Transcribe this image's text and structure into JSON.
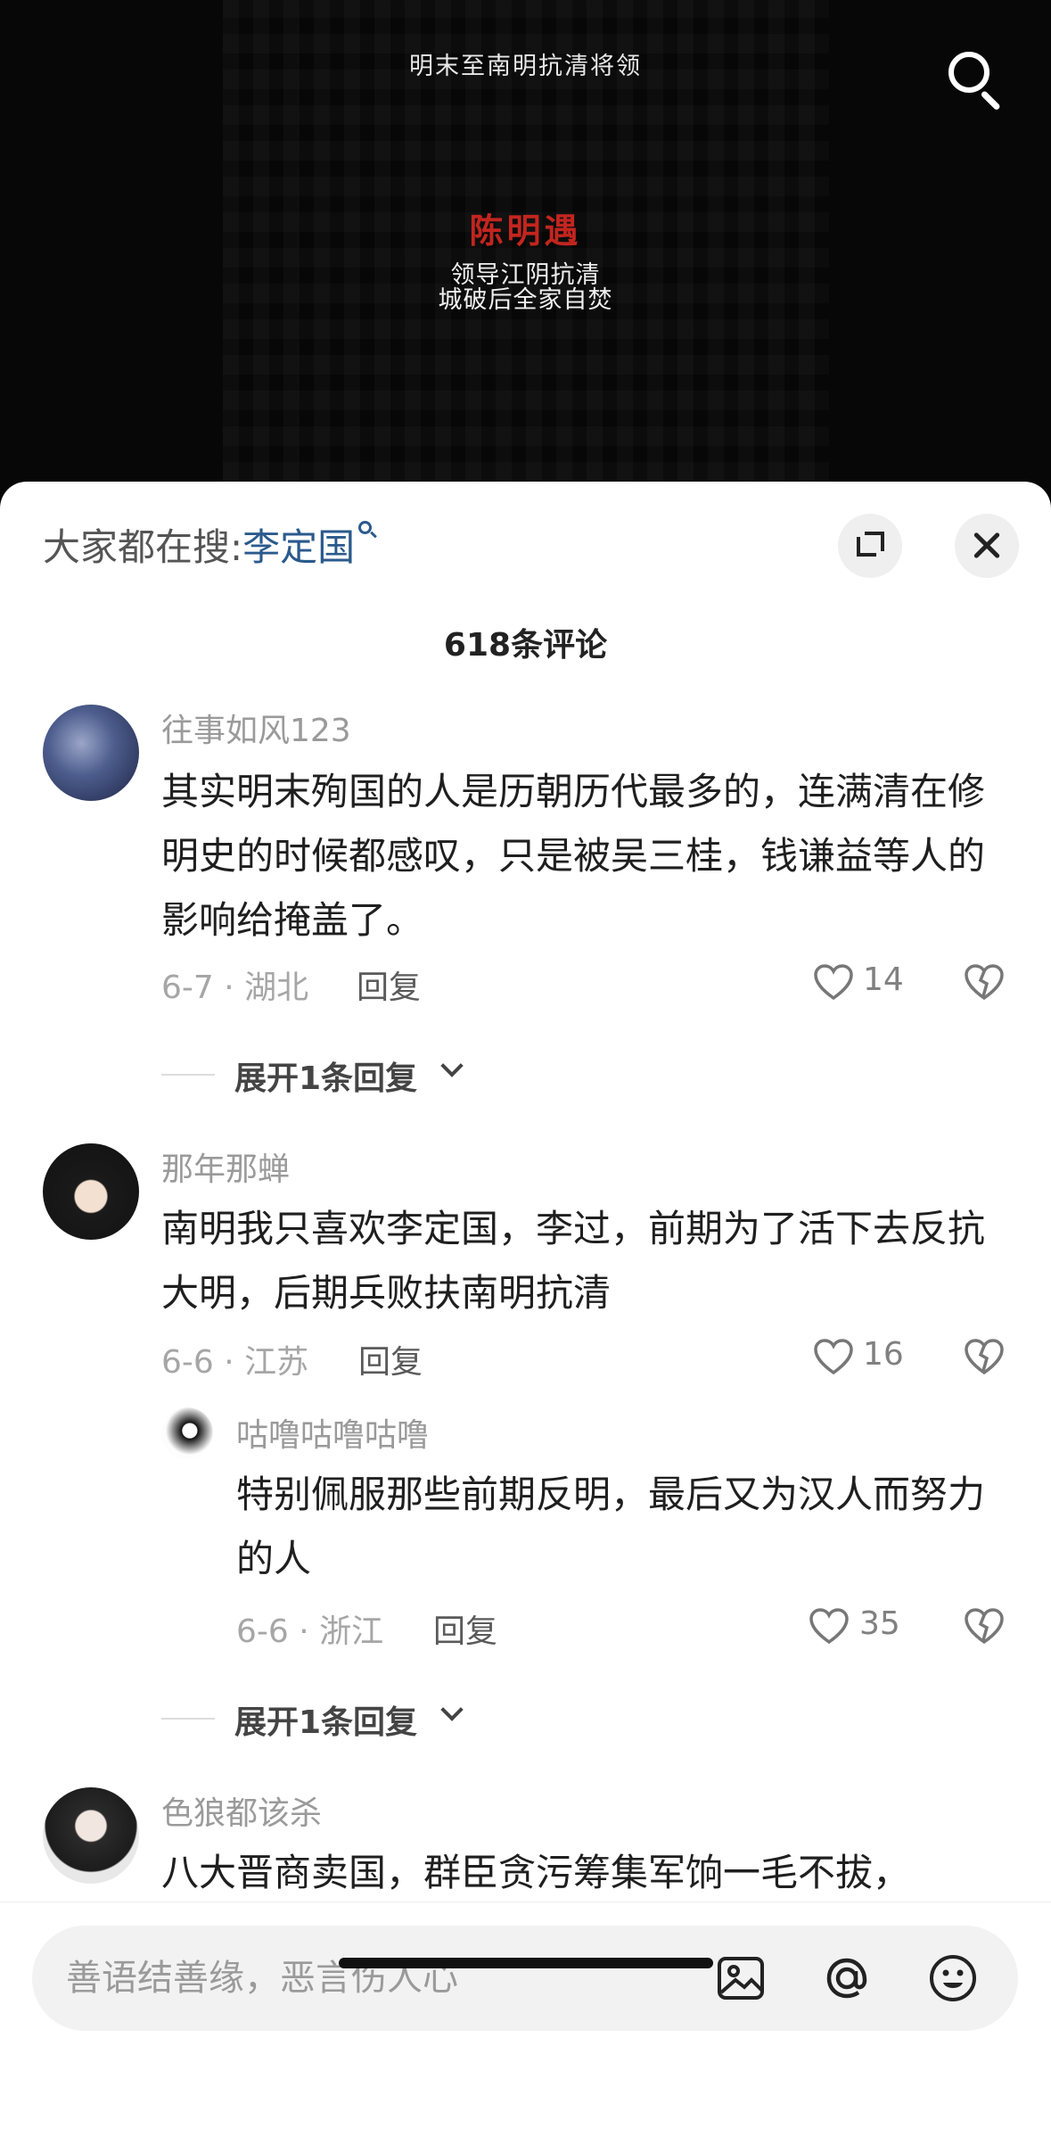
{
  "video": {
    "top_caption": "明末至南明抗清将领",
    "hero_name": "陈明遇",
    "hero_lines": [
      "领导江阴抗清",
      "城破后全家自焚"
    ]
  },
  "sheet": {
    "suggest_prefix": "大家都在搜:",
    "suggest_keyword": "李定国",
    "comment_count": "618条评论"
  },
  "comments": [
    {
      "user": "往事如风123",
      "text": "其实明末殉国的人是历朝历代最多的，连满清在修明史的时候都感叹，只是被吴三桂，钱谦益等人的影响给掩盖了。",
      "meta": "6-7 · 湖北",
      "reply": "回复",
      "likes": "14",
      "expand": "展开1条回复"
    },
    {
      "user": "那年那蝉",
      "text": "南明我只喜欢李定国，李过，前期为了活下去反抗大明，后期兵败扶南明抗清",
      "meta": "6-6 · 江苏",
      "reply": "回复",
      "likes": "16"
    },
    {
      "user": "咕噜咕噜咕噜",
      "text": "特别佩服那些前期反明，最后又为汉人而努力的人",
      "meta": "6-6 · 浙江",
      "reply": "回复",
      "likes": "35",
      "expand": "展开1条回复"
    },
    {
      "user": "色狼都该杀",
      "text": "八大晋商卖国，群臣贪污筹集军饷一毛不拔，"
    }
  ],
  "input": {
    "placeholder": "善语结善缘，恶言伤人心"
  },
  "icons": {
    "search": "search-icon",
    "expand": "expand-icon",
    "close": "close-icon",
    "like": "heart-icon",
    "dislike": "broken-heart-icon",
    "image": "image-icon",
    "mention": "at-icon",
    "emoji": "emoji-icon"
  }
}
